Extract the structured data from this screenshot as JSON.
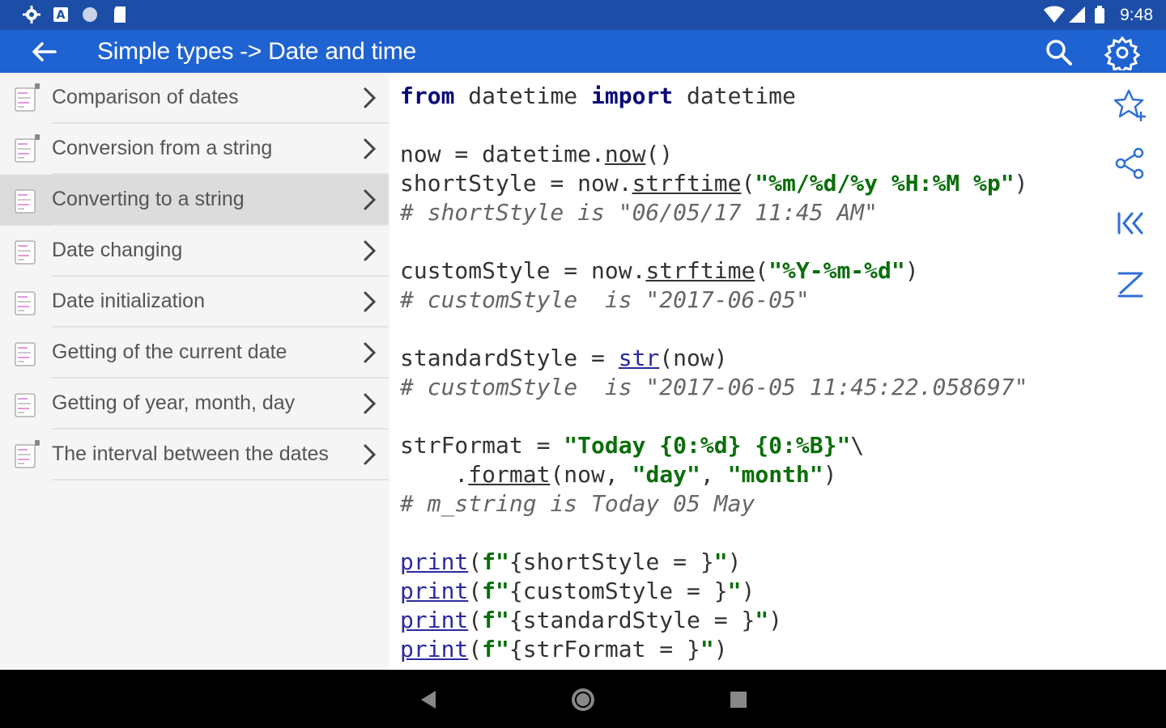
{
  "status_bar": {
    "time": "9:48",
    "left_icons": [
      "settings-icon",
      "a-icon",
      "circle-icon",
      "sd-card-icon"
    ],
    "right_icons": [
      "wifi-icon",
      "signal-icon",
      "battery-icon"
    ]
  },
  "app_bar": {
    "title": "Simple types -> Date and time",
    "back_icon": "arrow-left-icon",
    "search_icon": "search-icon",
    "settings_icon": "gear-icon",
    "color": "#1f63d2"
  },
  "list": {
    "selected_index": 2,
    "items": [
      {
        "label": "Comparison of dates",
        "locked": true
      },
      {
        "label": "Conversion from a string",
        "locked": true
      },
      {
        "label": "Converting to a string",
        "locked": false
      },
      {
        "label": "Date changing",
        "locked": false
      },
      {
        "label": "Date initialization",
        "locked": false
      },
      {
        "label": "Getting of the current date",
        "locked": false
      },
      {
        "label": "Getting of year, month, day",
        "locked": false
      },
      {
        "label": "The interval between the dates",
        "locked": true
      }
    ]
  },
  "code": {
    "lines": [
      [
        {
          "t": "from",
          "c": "kw"
        },
        {
          "t": " datetime ",
          "c": ""
        },
        {
          "t": "import",
          "c": "kw"
        },
        {
          "t": " datetime",
          "c": ""
        }
      ],
      [],
      [
        {
          "t": "now = datetime.",
          "c": ""
        },
        {
          "t": "now",
          "c": "fn"
        },
        {
          "t": "()",
          "c": ""
        }
      ],
      [
        {
          "t": "shortStyle = now.",
          "c": ""
        },
        {
          "t": "strftime",
          "c": "fn"
        },
        {
          "t": "(",
          "c": ""
        },
        {
          "t": "\"%m/%d/%y %H:%M %p\"",
          "c": "str"
        },
        {
          "t": ")",
          "c": ""
        }
      ],
      [
        {
          "t": "# shortStyle is \"06/05/17 11:45 AM\"",
          "c": "cm"
        }
      ],
      [],
      [
        {
          "t": "customStyle = now.",
          "c": ""
        },
        {
          "t": "strftime",
          "c": "fn"
        },
        {
          "t": "(",
          "c": ""
        },
        {
          "t": "\"%Y-%m-%d\"",
          "c": "str"
        },
        {
          "t": ")",
          "c": ""
        }
      ],
      [
        {
          "t": "# customStyle  is \"2017-06-05\"",
          "c": "cm"
        }
      ],
      [],
      [
        {
          "t": "standardStyle = ",
          "c": ""
        },
        {
          "t": "str",
          "c": "bi"
        },
        {
          "t": "(now)",
          "c": ""
        }
      ],
      [
        {
          "t": "# customStyle  is \"2017-06-05 11:45:22.058697\"",
          "c": "cm"
        }
      ],
      [],
      [
        {
          "t": "strFormat = ",
          "c": ""
        },
        {
          "t": "\"Today {0:%d} {0:%B}\"",
          "c": "str"
        },
        {
          "t": "\\",
          "c": ""
        }
      ],
      [
        {
          "t": "    .",
          "c": ""
        },
        {
          "t": "format",
          "c": "fn"
        },
        {
          "t": "(now, ",
          "c": ""
        },
        {
          "t": "\"day\"",
          "c": "str"
        },
        {
          "t": ", ",
          "c": ""
        },
        {
          "t": "\"month\"",
          "c": "str"
        },
        {
          "t": ")",
          "c": ""
        }
      ],
      [
        {
          "t": "# m_string is Today 05 May",
          "c": "cm"
        }
      ],
      [],
      [
        {
          "t": "print",
          "c": "bi"
        },
        {
          "t": "(",
          "c": ""
        },
        {
          "t": "f\"",
          "c": "str"
        },
        {
          "t": "{shortStyle = }",
          "c": ""
        },
        {
          "t": "\"",
          "c": "str"
        },
        {
          "t": ")",
          "c": ""
        }
      ],
      [
        {
          "t": "print",
          "c": "bi"
        },
        {
          "t": "(",
          "c": ""
        },
        {
          "t": "f\"",
          "c": "str"
        },
        {
          "t": "{customStyle = }",
          "c": ""
        },
        {
          "t": "\"",
          "c": "str"
        },
        {
          "t": ")",
          "c": ""
        }
      ],
      [
        {
          "t": "print",
          "c": "bi"
        },
        {
          "t": "(",
          "c": ""
        },
        {
          "t": "f\"",
          "c": "str"
        },
        {
          "t": "{standardStyle = }",
          "c": ""
        },
        {
          "t": "\"",
          "c": "str"
        },
        {
          "t": ")",
          "c": ""
        }
      ],
      [
        {
          "t": "print",
          "c": "bi"
        },
        {
          "t": "(",
          "c": ""
        },
        {
          "t": "f\"",
          "c": "str"
        },
        {
          "t": "{strFormat = }",
          "c": ""
        },
        {
          "t": "\"",
          "c": "str"
        },
        {
          "t": ")",
          "c": ""
        }
      ]
    ]
  },
  "actions": [
    "star-add-icon",
    "share-icon",
    "skip-back-icon",
    "sum-icon"
  ],
  "nav_bar": [
    "back-triangle-icon",
    "home-circle-icon",
    "recents-square-icon"
  ],
  "colors": {
    "status_bar": "#1c4ea8",
    "app_bar": "#1f63d2",
    "accent": "#2f6fd6",
    "keyword": "#0a0a7a",
    "string": "#0b6e0b",
    "comment": "#666666"
  }
}
